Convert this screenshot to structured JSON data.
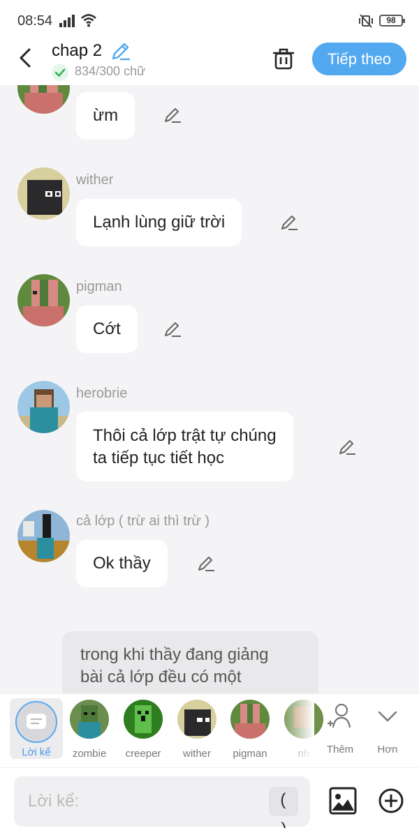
{
  "status": {
    "time": "08:54",
    "battery": "98"
  },
  "header": {
    "title": "chap 2",
    "word_count": "834/300 chữ",
    "next_label": "Tiếp theo"
  },
  "messages": [
    {
      "speaker": "",
      "text": "ừm"
    },
    {
      "speaker": "wither",
      "text": "Lạnh lùng giữ trời"
    },
    {
      "speaker": "pigman",
      "text": "Cớt"
    },
    {
      "speaker": "herobrie",
      "text_line1": "Thôi cả lớp trật tự chúng",
      "text_line2": "ta tiếp tục tiết học"
    },
    {
      "speaker": "cả lớp ( trừ ai thì trừ )",
      "text": "Ok thầy"
    }
  ],
  "narration": {
    "line1": "trong khi thầy đang giảng",
    "line2": "bài cả lớp đều có một"
  },
  "characters": {
    "narrator": "Lời kể",
    "list": [
      "zombie",
      "creeper",
      "wither",
      "pigman",
      "nh"
    ],
    "add_label": "Thêm",
    "more_label": "Hơn"
  },
  "input": {
    "placeholder": "Lời kể:",
    "paren": "( )"
  },
  "colors": {
    "accent": "#52a9f0",
    "bubble": "#ffffff",
    "background": "#f4f4f6"
  }
}
